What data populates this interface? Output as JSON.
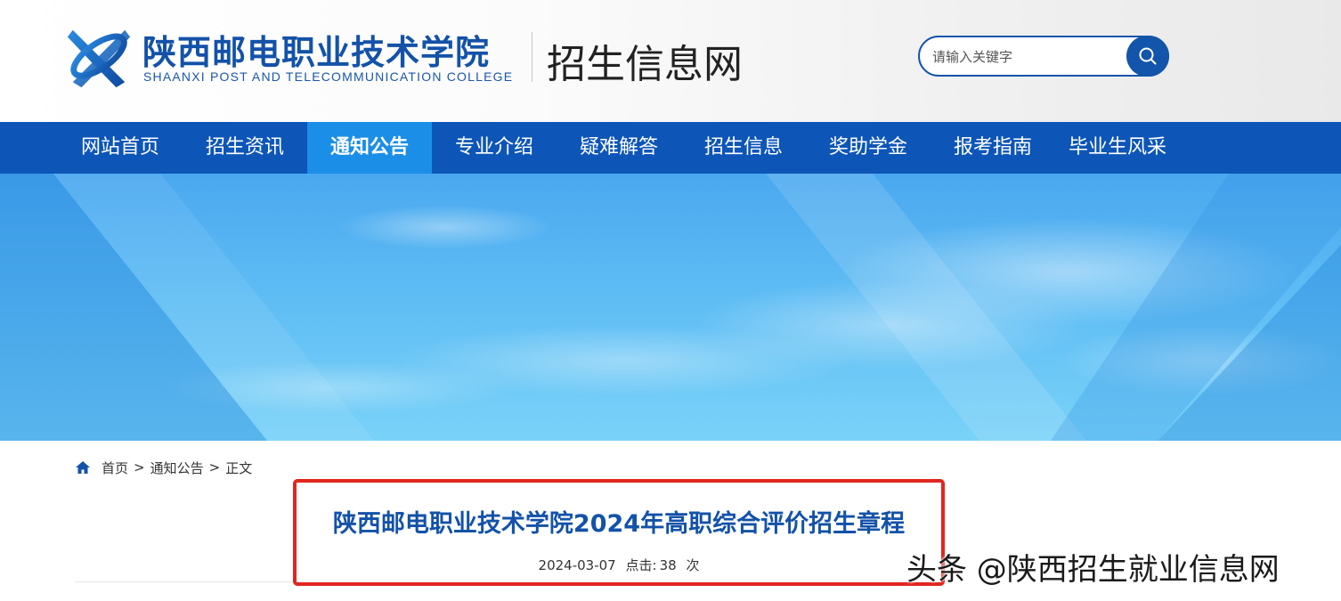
{
  "header": {
    "school_name_cn": "陕西邮电职业技术学院",
    "school_name_en": "SHAANXI POST AND TELECOMMUNICATION COLLEGE",
    "site_title": "招生信息网",
    "logo_icon": "college-logo",
    "search": {
      "placeholder": "请输入关键字",
      "value": "",
      "button_icon": "search-icon"
    }
  },
  "nav": {
    "items": [
      {
        "label": "网站首页",
        "active": false
      },
      {
        "label": "招生资讯",
        "active": false
      },
      {
        "label": "通知公告",
        "active": true
      },
      {
        "label": "专业介绍",
        "active": false
      },
      {
        "label": "疑难解答",
        "active": false
      },
      {
        "label": "招生信息",
        "active": false
      },
      {
        "label": "奖助学金",
        "active": false
      },
      {
        "label": "报考指南",
        "active": false
      },
      {
        "label": "毕业生风采",
        "active": false
      }
    ]
  },
  "breadcrumb": {
    "home_icon": "home-icon",
    "items": [
      "首页",
      "通知公告",
      "正文"
    ],
    "separator": ">"
  },
  "article": {
    "title": "陕西邮电职业技术学院2024年高职综合评价招生章程",
    "date": "2024-03-07",
    "views_label": "点击:",
    "views_count": "38",
    "views_unit": "次"
  },
  "watermark": "头条 @陕西招生就业信息网",
  "colors": {
    "brand_blue": "#1352a8",
    "nav_blue": "#0d56b8",
    "nav_active": "#1b8ee8",
    "highlight_red": "#e0261f"
  }
}
